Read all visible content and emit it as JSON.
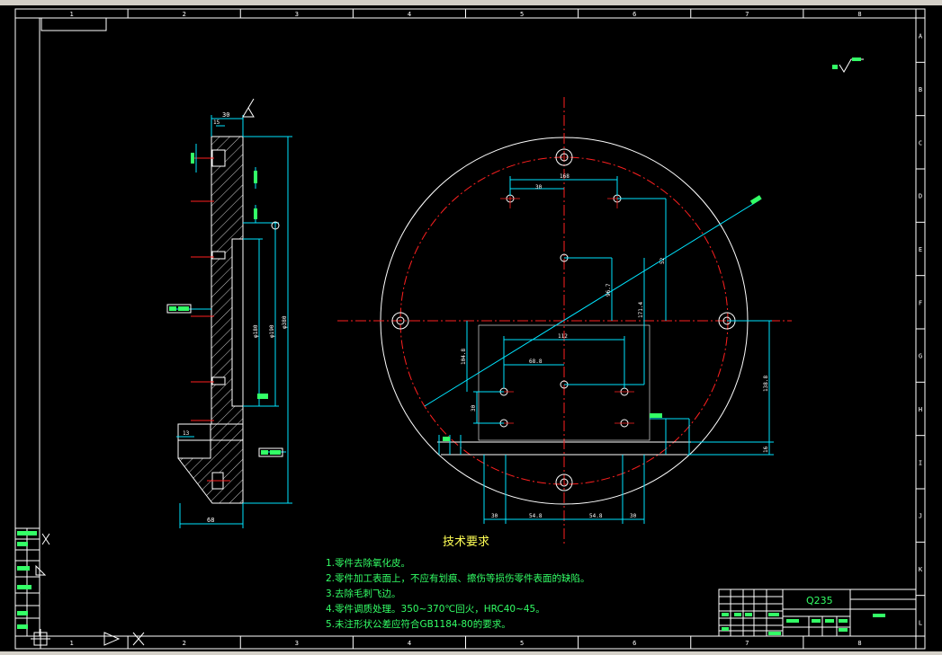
{
  "border": {
    "columns": [
      "1",
      "2",
      "3",
      "4",
      "5",
      "6",
      "7",
      "8"
    ],
    "rows": [
      "A",
      "B",
      "C",
      "D",
      "E",
      "F",
      "G",
      "H",
      "I",
      "J",
      "K",
      "L"
    ]
  },
  "dimensions": {
    "top_30": "30",
    "top_168": "168",
    "dim_112": "112",
    "dim_68_8": "68.8",
    "dim_30_left": "30",
    "dim_104_8": "104.8",
    "dim_54_8_left": "54.8",
    "dim_54_8_right": "54.8",
    "dim_30_bottom_left": "30",
    "dim_30_bottom_right": "30",
    "dim_138_8": "138.8",
    "dim_16": "16",
    "dim_171_4": "171.4",
    "dim_96_7": "96.7",
    "dim_52": "52",
    "side_30": "30",
    "side_15": "15",
    "side_68": "68",
    "side_13": "13",
    "side_d180": "φ180",
    "side_d190": "φ190",
    "side_d380": "φ380"
  },
  "tech": {
    "title": "技术要求",
    "lines": [
      "1.零件去除氧化皮。",
      "2.零件加工表面上，不应有划痕、擦伤等损伤零件表面的缺陷。",
      "3.去除毛刺飞边。",
      "4.零件调质处理。350~370℃回火，HRC40~45。",
      "5.未注形状公差应符合GB1184-80的要求。"
    ]
  },
  "title_block": {
    "material": "Q235"
  },
  "colors": {
    "outline": "#ffffff",
    "dimension": "#00e5ff",
    "centerline": "#ff2020",
    "hatch": "#ffffff",
    "text_green": "#33ff66",
    "text_yellow": "#ffff55"
  }
}
